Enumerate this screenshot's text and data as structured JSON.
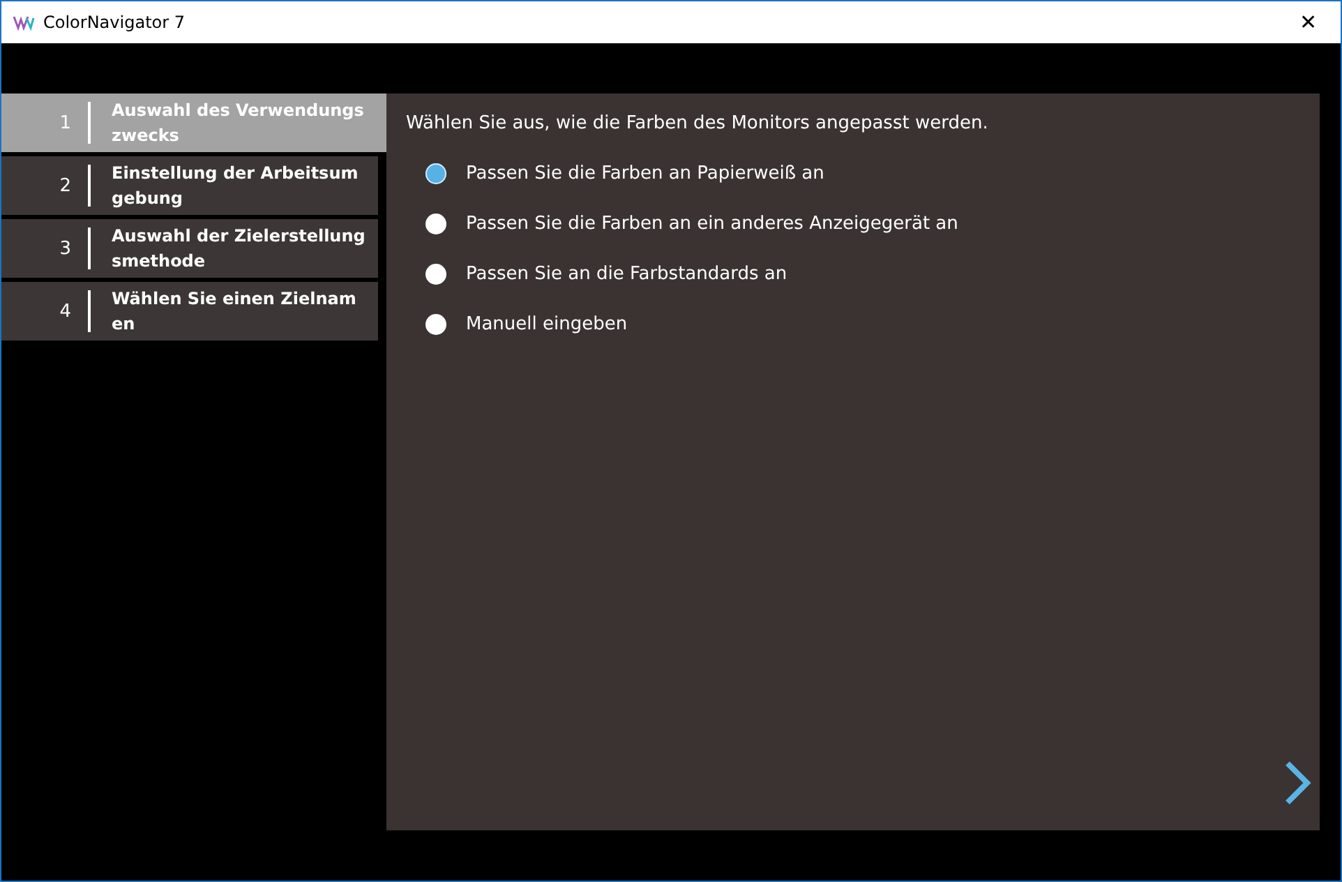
{
  "window": {
    "title": "ColorNavigator 7",
    "close": "✕"
  },
  "steps": [
    {
      "number": "1",
      "label": "Auswahl des Verwendungs\nzwecks",
      "selected": true
    },
    {
      "number": "2",
      "label": "Einstellung der Arbeitsum\ngebung",
      "selected": false
    },
    {
      "number": "3",
      "label": "Auswahl der Zielerstellung\nsmethode",
      "selected": false
    },
    {
      "number": "4",
      "label": "Wählen Sie einen Zielnam\nen",
      "selected": false
    }
  ],
  "prompt": "Wählen Sie aus, wie die Farben des Monitors angepasst werden.",
  "options": [
    {
      "label": "Passen Sie die Farben an Papierweiß an",
      "selected": true
    },
    {
      "label": "Passen Sie die Farben an ein anderes Anzeigegerät an",
      "selected": false
    },
    {
      "label": "Passen Sie an die Farbstandards an",
      "selected": false
    },
    {
      "label": "Manuell eingeben",
      "selected": false
    }
  ]
}
